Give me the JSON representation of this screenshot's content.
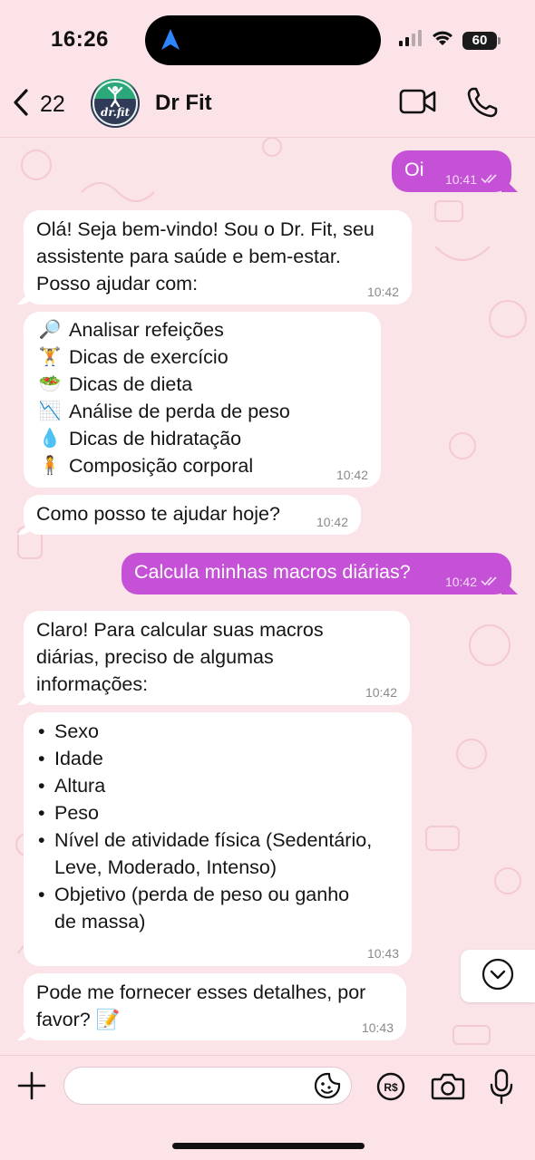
{
  "status_bar": {
    "time": "16:26",
    "battery": "60"
  },
  "header": {
    "back_count": "22",
    "contact_name": "Dr Fit",
    "avatar_text": "dr.fit"
  },
  "messages": [
    {
      "id": "m1",
      "dir": "out",
      "text": "Oi",
      "time": "10:41"
    },
    {
      "id": "m2",
      "dir": "in",
      "lines": [
        "Olá! Seja bem-vindo! Sou o Dr. Fit, seu",
        "assistente para saúde e bem-estar.",
        "Posso ajudar com:"
      ],
      "time": "10:42"
    },
    {
      "id": "m3",
      "dir": "in",
      "items": [
        {
          "emoji": "🔎",
          "text": "Analisar refeições"
        },
        {
          "emoji": "🏋️",
          "text": "Dicas de exercício"
        },
        {
          "emoji": "🥗",
          "text": "Dicas de dieta"
        },
        {
          "emoji": "📉",
          "text": "Análise de perda de peso"
        },
        {
          "emoji": "💧",
          "text": "Dicas de hidratação"
        },
        {
          "emoji": "🧍",
          "text": "Composição corporal"
        }
      ],
      "time": "10:42"
    },
    {
      "id": "m4",
      "dir": "in",
      "text": "Como posso te ajudar hoje?",
      "time": "10:42"
    },
    {
      "id": "m5",
      "dir": "out",
      "text": "Calcula minhas macros diárias?",
      "time": "10:42"
    },
    {
      "id": "m6",
      "dir": "in",
      "lines": [
        "Claro! Para calcular suas macros",
        "diárias, preciso de algumas",
        "informações:"
      ],
      "time": "10:42"
    },
    {
      "id": "m7",
      "dir": "in",
      "bullets": [
        [
          "Sexo"
        ],
        [
          "Idade"
        ],
        [
          "Altura"
        ],
        [
          "Peso"
        ],
        [
          "Nível de atividade física (Sedentário,",
          "Leve, Moderado, Intenso)"
        ],
        [
          "Objetivo (perda de peso ou ganho",
          "de massa)"
        ]
      ],
      "time": "10:43"
    },
    {
      "id": "m8",
      "dir": "in",
      "lines": [
        "Pode me fornecer esses detalhes, por",
        "favor? 📝"
      ],
      "time": "10:43"
    }
  ],
  "input": {
    "placeholder": ""
  },
  "colors": {
    "outgoing_bubble": "#c552d6",
    "incoming_bubble": "#ffffff",
    "background": "#fbe4e8"
  }
}
